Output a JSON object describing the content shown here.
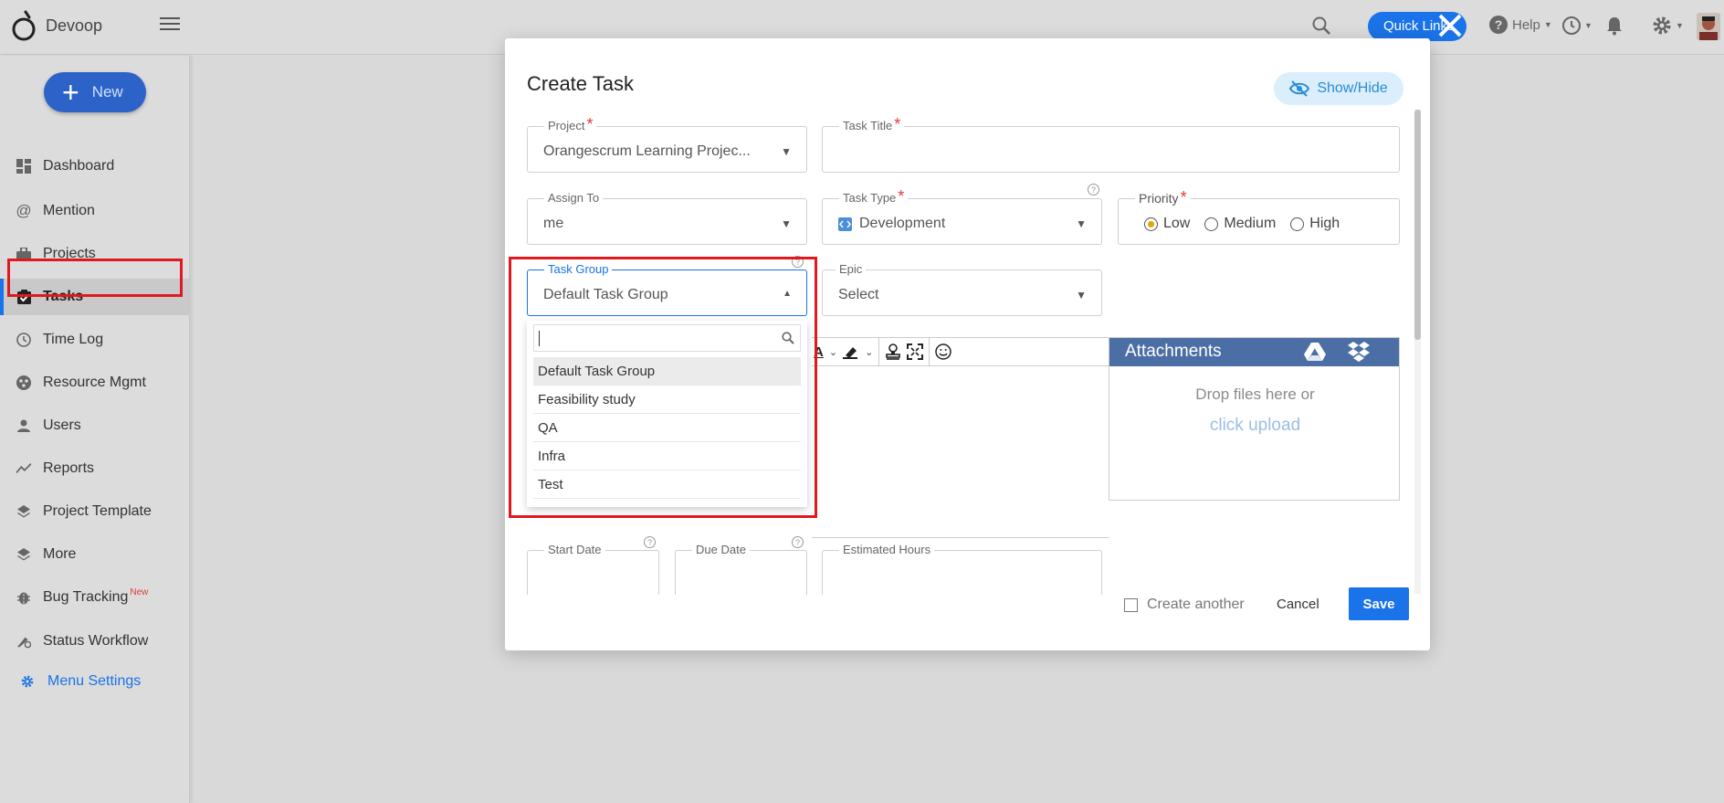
{
  "app": {
    "name": "Devoop"
  },
  "topbar": {
    "quick_links": "Quick Links",
    "help": "Help"
  },
  "sidebar": {
    "new_label": "New",
    "items": [
      {
        "label": "Dashboard",
        "icon": "dashboard-icon"
      },
      {
        "label": "Mention",
        "icon": "at-icon"
      },
      {
        "label": "Projects",
        "icon": "briefcase-icon"
      },
      {
        "label": "Tasks",
        "icon": "clipboard-check-icon",
        "active": true
      },
      {
        "label": "Time Log",
        "icon": "clock-icon"
      },
      {
        "label": "Resource Mgmt",
        "icon": "resource-icon"
      },
      {
        "label": "Users",
        "icon": "user-icon"
      },
      {
        "label": "Reports",
        "icon": "trend-icon"
      },
      {
        "label": "Project Template",
        "icon": "layers-icon"
      },
      {
        "label": "More",
        "icon": "layers-icon"
      },
      {
        "label": "Bug Tracking",
        "icon": "bug-icon",
        "badge": "New"
      },
      {
        "label": "Status Workflow",
        "icon": "workflow-icon"
      }
    ],
    "menu_settings": "Menu Settings"
  },
  "modal": {
    "title": "Create Task",
    "show_hide": "Show/Hide",
    "project": {
      "label": "Project",
      "value": "Orangescrum Learning Projec..."
    },
    "task_title": {
      "label": "Task Title",
      "value": ""
    },
    "assign_to": {
      "label": "Assign To",
      "value": "me"
    },
    "task_type": {
      "label": "Task Type",
      "value": "Development"
    },
    "priority": {
      "label": "Priority",
      "options": [
        "Low",
        "Medium",
        "High"
      ],
      "selected": "Low"
    },
    "task_group": {
      "label": "Task Group",
      "value": "Default Task Group"
    },
    "epic": {
      "label": "Epic",
      "value": "Select"
    },
    "attachments": {
      "title": "Attachments",
      "drop_text": "Drop files here or",
      "upload_link": "click upload"
    },
    "start_date": {
      "label": "Start Date"
    },
    "due_date": {
      "label": "Due Date"
    },
    "estimated_hours": {
      "label": "Estimated Hours"
    },
    "create_another": "Create another",
    "cancel": "Cancel",
    "save": "Save"
  },
  "task_group_dropdown": {
    "search_value": "",
    "options": [
      "Default Task Group",
      "Feasibility study",
      "QA",
      "Infra",
      "Test"
    ],
    "selected": "Default Task Group"
  },
  "colors": {
    "accent": "#1a73e8",
    "highlight": "#e0191f",
    "attachments_header": "#4b6fa5"
  }
}
